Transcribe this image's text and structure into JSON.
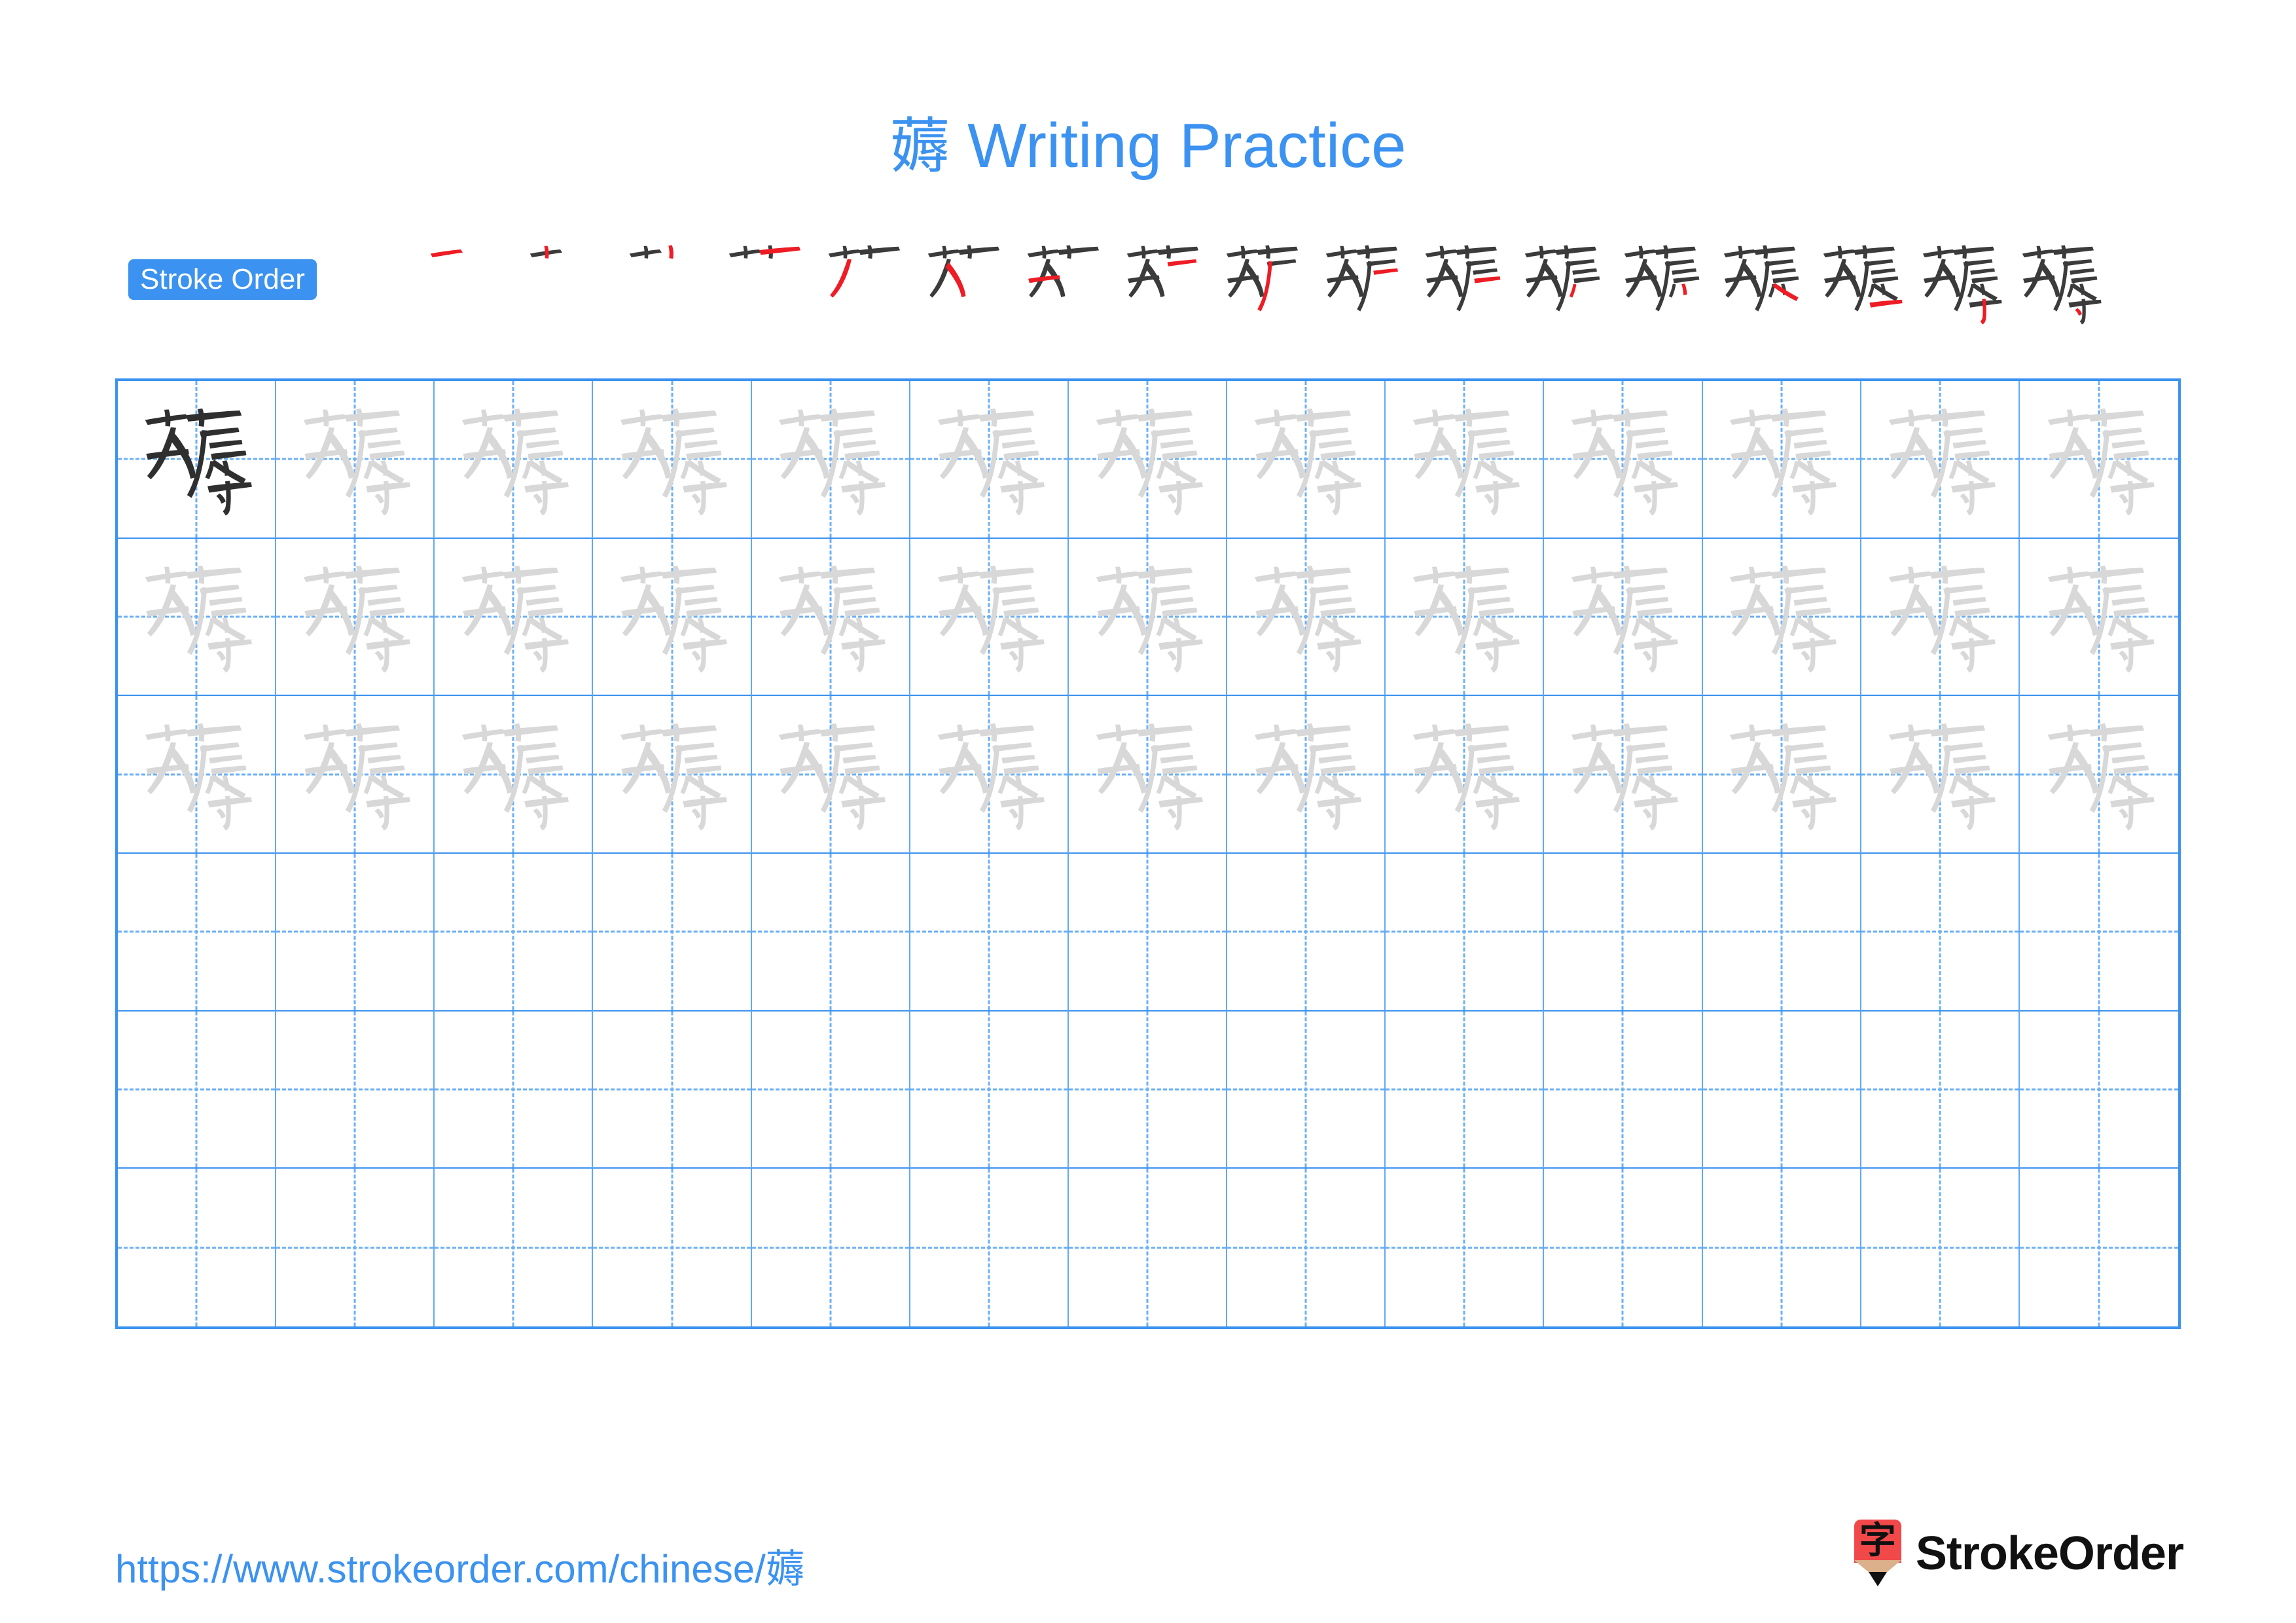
{
  "character": "薅",
  "title": {
    "character": "薅",
    "text": " Writing Practice",
    "full": "薅 Writing Practice",
    "color": "#3b92f0"
  },
  "stroke_order": {
    "label": "Stroke Order",
    "badge_color": "#3b92f0",
    "badge_text_color": "#ffffff",
    "new_stroke_color": "#ee1c24",
    "prev_stroke_color": "#3b3b3b",
    "total_strokes": 17,
    "steps": [
      1,
      2,
      3,
      4,
      5,
      6,
      7,
      8,
      9,
      10,
      11,
      12,
      13,
      14,
      15,
      16,
      17
    ]
  },
  "grid": {
    "columns": 13,
    "rows": 6,
    "border_color": "#3b92f0",
    "inner_line_color": "#62a9f4",
    "guide_color": "#6cb0f6",
    "model_color": "#2f2f2f",
    "trace_color": "#d8d8d8",
    "filled_rows": 3,
    "blank_rows": 3,
    "model_cell_index": 0
  },
  "footer": {
    "url_prefix": "https://www.strokeorder.com/chinese/",
    "url_character": "薅",
    "url": "https://www.strokeorder.com/chinese/薅",
    "url_color": "#3b92f0",
    "brand_name": "StrokeOrder",
    "brand_mark_character": "字",
    "brand_mark_color": "#f1484a",
    "brand_wood_color": "#dcb08a",
    "brand_tip_color": "#111111"
  }
}
